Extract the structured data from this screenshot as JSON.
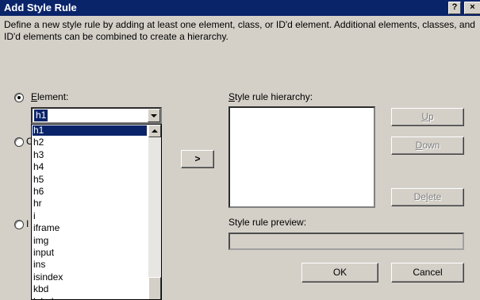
{
  "window": {
    "title": "Add Style Rule",
    "help_glyph": "?",
    "close_glyph": "×"
  },
  "description": "Define a new style rule by adding at least one element, class, or ID'd element.  Additional elements, classes, and ID'd elements can be combined to create a hierarchy.",
  "element_option": {
    "accel": "E",
    "label_rest": "lement:",
    "selected": true,
    "combo_value": "h1",
    "dropdown_items": [
      "h1",
      "h2",
      "h3",
      "h4",
      "h5",
      "h6",
      "hr",
      "i",
      "iframe",
      "img",
      "input",
      "ins",
      "isindex",
      "kbd",
      "label"
    ],
    "dropdown_selected_index": 0
  },
  "class_option_partial": "C",
  "id_option_partial": "I",
  "add_button": {
    "label": ">"
  },
  "hierarchy": {
    "accel": "S",
    "label_rest": "tyle rule hierarchy:"
  },
  "buttons": {
    "up": {
      "accel": "U",
      "rest": "p",
      "enabled": false
    },
    "down": {
      "accel": "D",
      "rest": "own",
      "enabled": false
    },
    "delete": {
      "pre": "De",
      "accel": "l",
      "rest": "ete",
      "enabled": false
    },
    "ok": {
      "label": "OK"
    },
    "cancel": {
      "label": "Cancel"
    }
  },
  "preview": {
    "label": "Style rule preview:",
    "value": ""
  }
}
